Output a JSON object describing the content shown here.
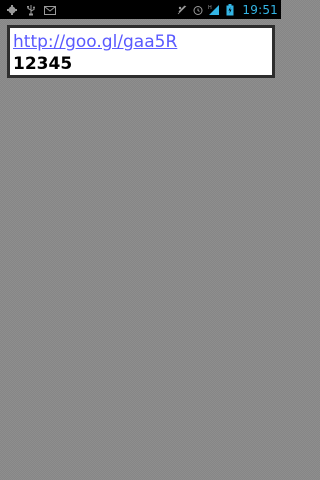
{
  "status_bar": {
    "time": "19:51",
    "left_icons": [
      "android-debug-icon",
      "usb-icon",
      "gmail-icon"
    ],
    "right_icons": [
      "sync-off-icon",
      "alarm-icon",
      "signal-icon",
      "battery-icon"
    ],
    "accent_color": "#33b5e5",
    "background_color": "#000000"
  },
  "widget": {
    "link_text": "http://goo.gl/gaa5R",
    "value_text": "12345",
    "link_color": "#5a5aff",
    "border_color": "#2e2e2e"
  }
}
